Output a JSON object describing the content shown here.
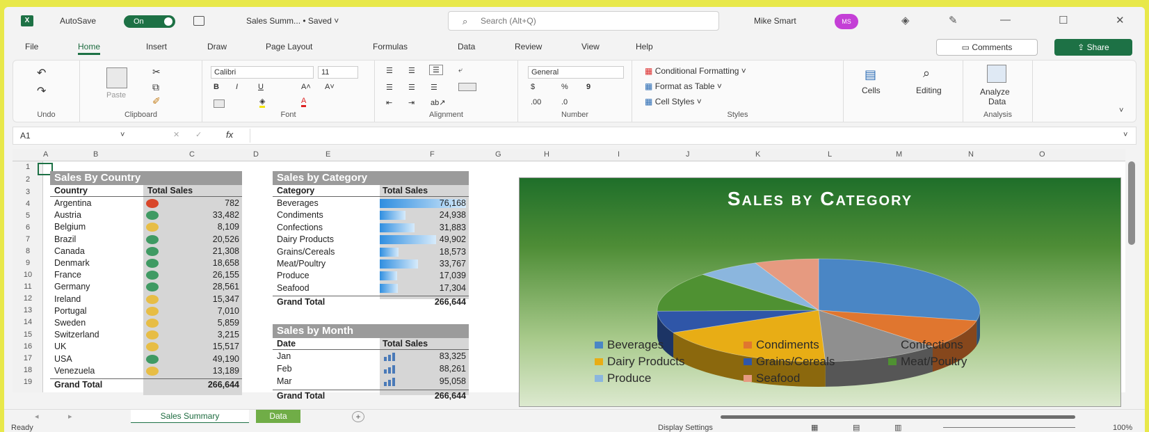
{
  "titlebar": {
    "autosave_label": "AutoSave",
    "autosave_state": "On",
    "doc_title": "Sales Summ... • Saved ˅",
    "search_placeholder": "Search (Alt+Q)",
    "user_name": "Mike Smart",
    "avatar_initials": "MS"
  },
  "tabs": [
    "File",
    "Home",
    "Insert",
    "Draw",
    "Page Layout",
    "Formulas",
    "Data",
    "Review",
    "View",
    "Help"
  ],
  "active_tab": "Home",
  "buttons": {
    "comments": "Comments",
    "share": "Share"
  },
  "ribbon": {
    "groups": [
      "Undo",
      "Clipboard",
      "Font",
      "Alignment",
      "Number",
      "Styles",
      "Cells",
      "Editing",
      "Analysis"
    ],
    "paste_label": "Paste",
    "font_name": "Calibri",
    "font_size": "11",
    "number_format": "General",
    "styles_items": [
      "Conditional Formatting ˅",
      "Format as Table ˅",
      "Cell Styles ˅"
    ],
    "cells_label": "Cells",
    "editing_label": "Editing",
    "analyze_label_1": "Analyze",
    "analyze_label_2": "Data"
  },
  "formula_bar": {
    "name_box": "A1",
    "fx": "fx"
  },
  "columns": [
    "A",
    "B",
    "C",
    "D",
    "E",
    "F",
    "G",
    "H",
    "I",
    "J",
    "K",
    "L",
    "M",
    "N",
    "O"
  ],
  "rows": [
    "1",
    "2",
    "3",
    "4",
    "5",
    "6",
    "7",
    "8",
    "9",
    "10",
    "11",
    "12",
    "13",
    "14",
    "15",
    "16",
    "17",
    "18",
    "19"
  ],
  "country_table": {
    "title": "Sales By Country",
    "headers": [
      "Country",
      "Total Sales"
    ],
    "rows": [
      {
        "country": "Argentina",
        "sales": "782",
        "status": "red"
      },
      {
        "country": "Austria",
        "sales": "33,482",
        "status": "green"
      },
      {
        "country": "Belgium",
        "sales": "8,109",
        "status": "yellow"
      },
      {
        "country": "Brazil",
        "sales": "20,526",
        "status": "green"
      },
      {
        "country": "Canada",
        "sales": "21,308",
        "status": "green"
      },
      {
        "country": "Denmark",
        "sales": "18,658",
        "status": "green"
      },
      {
        "country": "France",
        "sales": "26,155",
        "status": "green"
      },
      {
        "country": "Germany",
        "sales": "28,561",
        "status": "green"
      },
      {
        "country": "Ireland",
        "sales": "15,347",
        "status": "yellow"
      },
      {
        "country": "Portugal",
        "sales": "7,010",
        "status": "yellow"
      },
      {
        "country": "Sweden",
        "sales": "5,859",
        "status": "yellow"
      },
      {
        "country": "Switzerland",
        "sales": "3,215",
        "status": "yellow"
      },
      {
        "country": "UK",
        "sales": "15,517",
        "status": "yellow"
      },
      {
        "country": "USA",
        "sales": "49,190",
        "status": "green"
      },
      {
        "country": "Venezuela",
        "sales": "13,189",
        "status": "yellow"
      }
    ],
    "total_label": "Grand Total",
    "total_value": "266,644"
  },
  "category_table": {
    "title": "Sales by Category",
    "headers": [
      "Category",
      "Total Sales"
    ],
    "rows": [
      {
        "category": "Beverages",
        "sales": "76,168",
        "fill": 1.0
      },
      {
        "category": "Condiments",
        "sales": "24,938",
        "fill": 0.3
      },
      {
        "category": "Confections",
        "sales": "31,883",
        "fill": 0.4
      },
      {
        "category": "Dairy Products",
        "sales": "49,902",
        "fill": 0.65
      },
      {
        "category": "Grains/Cereals",
        "sales": "18,573",
        "fill": 0.22
      },
      {
        "category": "Meat/Poultry",
        "sales": "33,767",
        "fill": 0.44
      },
      {
        "category": "Produce",
        "sales": "17,039",
        "fill": 0.2
      },
      {
        "category": "Seafood",
        "sales": "17,304",
        "fill": 0.21
      }
    ],
    "total_label": "Grand Total",
    "total_value": "266,644"
  },
  "month_table": {
    "title": "Sales by Month",
    "headers": [
      "Date",
      "Total Sales"
    ],
    "rows": [
      {
        "month": "Jan",
        "sales": "83,325"
      },
      {
        "month": "Feb",
        "sales": "88,261"
      },
      {
        "month": "Mar",
        "sales": "95,058"
      }
    ],
    "total_label": "Grand Total",
    "total_value": "266,644"
  },
  "chart_data": {
    "type": "pie",
    "title": "Sales by Category",
    "categories": [
      "Beverages",
      "Condiments",
      "Confections",
      "Dairy Products",
      "Grains/Cereals",
      "Meat/Poultry",
      "Produce",
      "Seafood"
    ],
    "values": [
      76168,
      24938,
      31883,
      49902,
      18573,
      33767,
      17039,
      17304
    ],
    "colors": [
      "#4a86c5",
      "#e0762f",
      "#8f8f8f",
      "#e8ad15",
      "#2f56a8",
      "#4f9132",
      "#8bb6de",
      "#e69a80"
    ],
    "legend_position": "bottom"
  },
  "sheet_tabs": [
    "Sales Summary",
    "Data"
  ],
  "status": {
    "ready": "Ready",
    "display": "Display Settings",
    "zoom": "100%"
  }
}
